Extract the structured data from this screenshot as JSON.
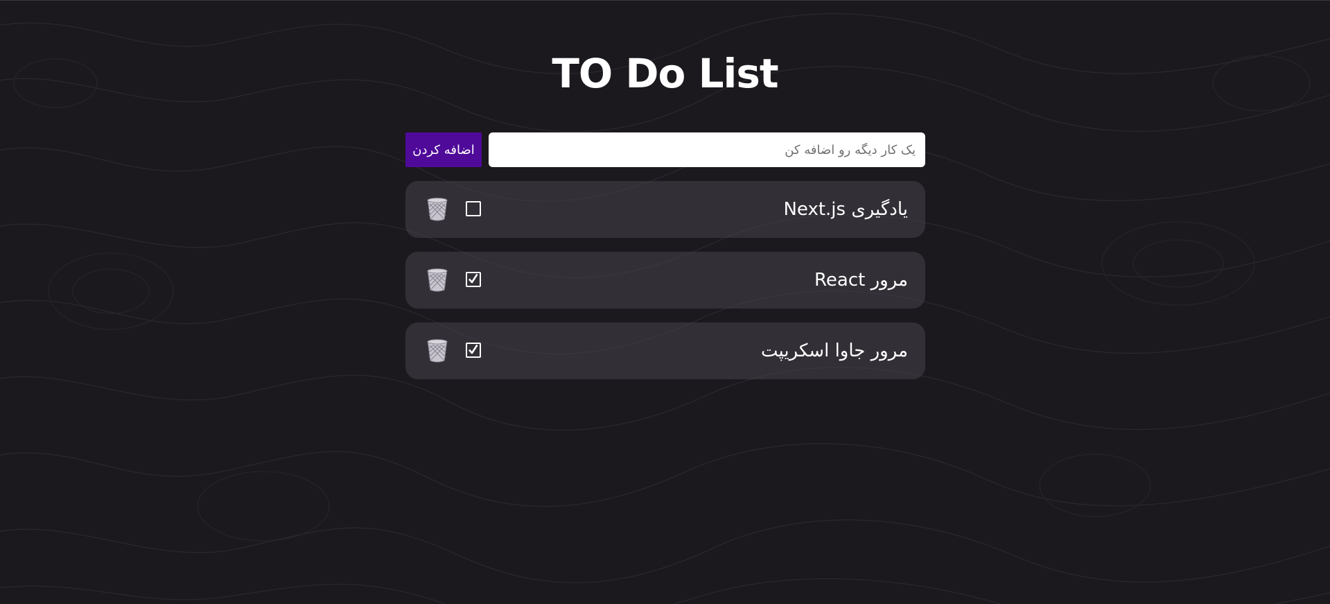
{
  "app": {
    "title": "TO Do List"
  },
  "form": {
    "input_value": "",
    "input_placeholder": "یک کار دیگه رو اضافه کن",
    "add_label": "اضافه کردن"
  },
  "todos": [
    {
      "text": "یادگیری Next.js",
      "done": false
    },
    {
      "text": "مرور React",
      "done": true
    },
    {
      "text": "مرور جاوا اسکریپت",
      "done": true
    }
  ],
  "icons": {
    "delete": "trash-icon",
    "checkbox_checked": "checkbox-checked-icon",
    "checkbox_unchecked": "checkbox-unchecked-icon"
  },
  "colors": {
    "background": "#1b181e",
    "card": "#35323a",
    "accent": "#4f0a9a",
    "text": "#ffffff"
  }
}
